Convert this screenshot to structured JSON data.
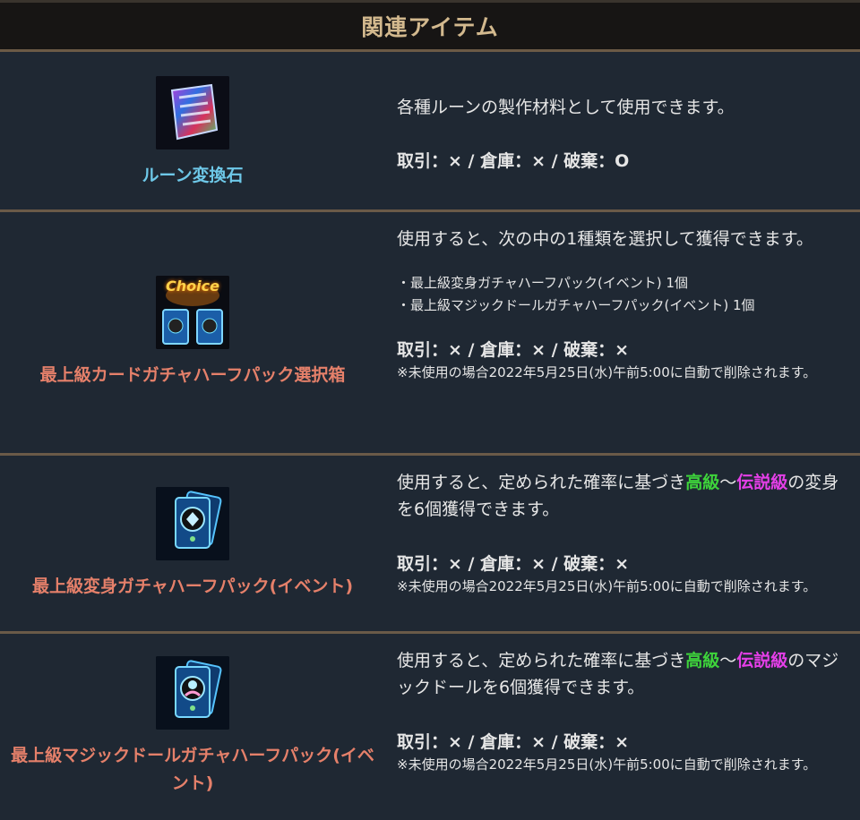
{
  "header": {
    "title": "関連アイテム"
  },
  "items": [
    {
      "name": "ルーン変換石",
      "icon": "rune-stone-icon",
      "desc": "各種ルーンの製作材料として使用できます。",
      "trade": "取引：× / 倉庫：× / 破棄：O"
    },
    {
      "name": "最上級カードガチャハーフパック選択箱",
      "icon": "choice-box-icon",
      "icon_label": "Choice",
      "desc": "使用すると、次の中の1種類を選択して獲得できます。",
      "list": [
        "・最上級変身ガチャハーフパック(イベント) 1個",
        "・最上級マジックドールガチャハーフパック(イベント) 1個"
      ],
      "trade": "取引：× / 倉庫：× / 破棄：×",
      "note": "※未使用の場合2022年5月25日(水)午前5:00に自動で削除されます。"
    },
    {
      "name": "最上級変身ガチャハーフパック(イベント)",
      "icon": "transform-card-pack-icon",
      "desc_pre": "使用すると、定められた確率に基づき",
      "grade_high": "高級",
      "tilde": "～",
      "grade_legend": "伝説級",
      "desc_post": "の変身を6個獲得できます。",
      "trade": "取引：× / 倉庫：× / 破棄：×",
      "note": "※未使用の場合2022年5月25日(水)午前5:00に自動で削除されます。"
    },
    {
      "name": "最上級マジックドールガチャハーフパック(イベント)",
      "icon": "magic-doll-card-pack-icon",
      "desc_pre": "使用すると、定められた確率に基づき",
      "grade_high": "高級",
      "tilde": "～",
      "grade_legend": "伝説級",
      "desc_post": "のマジックドールを6個獲得できます。",
      "trade": "取引：× / 倉庫：× / 破棄：×",
      "note": "※未使用の場合2022年5月25日(水)午前5:00に自動で削除されます。"
    }
  ],
  "colors": {
    "grade_high": "#3ed43b",
    "grade_legend": "#e53fe8",
    "name_blue": "#6ec8e8",
    "name_orange": "#e5806a"
  }
}
